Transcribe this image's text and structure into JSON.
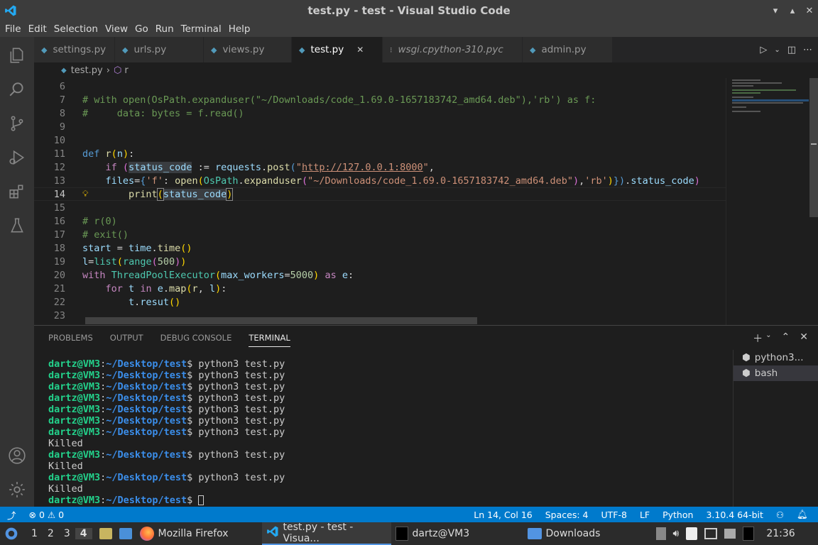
{
  "window": {
    "title": "test.py - test - Visual Studio Code"
  },
  "menu": [
    "File",
    "Edit",
    "Selection",
    "View",
    "Go",
    "Run",
    "Terminal",
    "Help"
  ],
  "tabs": [
    {
      "label": "settings.py",
      "italic": false
    },
    {
      "label": "urls.py",
      "italic": false
    },
    {
      "label": "views.py",
      "italic": false
    },
    {
      "label": "test.py",
      "italic": false,
      "active": true
    },
    {
      "label": "wsgi.cpython-310.pyc",
      "italic": true
    },
    {
      "label": "admin.py",
      "italic": false
    }
  ],
  "breadcrumb": {
    "file": "test.py",
    "symbol": "r"
  },
  "editor": {
    "lines": [
      {
        "n": "6",
        "html": ""
      },
      {
        "n": "7",
        "html": "<span class=\"cm\"># with open(OsPath.expanduser(\"~/Downloads/code_1.69.0-1657183742_amd64.deb\"),'rb') as f:</span>"
      },
      {
        "n": "8",
        "html": "<span class=\"cm\">#     data: bytes = f.read()</span>"
      },
      {
        "n": "9",
        "html": ""
      },
      {
        "n": "10",
        "html": ""
      },
      {
        "n": "11",
        "html": "<span class=\"kw\">def</span> <span class=\"fn\">r</span><span class=\"br\">(</span><span class=\"vr\">n</span><span class=\"br\">)</span>:"
      },
      {
        "n": "12",
        "html": "    <span class=\"kf\">if</span> <span class=\"br2\">(</span><span class=\"vr\" style=\"background:#3a3d41\">status_code</span> := <span class=\"vr\">requests</span>.<span class=\"fn\">post</span><span class=\"kw\">(</span><span class=\"st\">\"<u>http://127.0.0.1:8000</u>\"</span>,"
      },
      {
        "n": "13",
        "html": "    <span class=\"vr\">files</span>=<span class=\"kw\">{</span><span class=\"st\">'f'</span>: <span class=\"fn\">open</span><span class=\"br\">(</span><span class=\"ty\">OsPath</span>.<span class=\"fn\">expanduser</span><span class=\"br2\">(</span><span class=\"st\">\"~/Downloads/code_1.69.0-1657183742_amd64.deb\"</span><span class=\"br2\">)</span>,<span class=\"st\">'rb'</span><span class=\"br\">)</span><span class=\"kw\">})</span>.<span class=\"vr\">status_code</span><span class=\"br2\">)</span>"
      },
      {
        "n": "14",
        "html": "        <span class=\"fn\">print</span><span class=\"br\" style=\"outline:1px solid #888\">(</span><span class=\"vr\" style=\"background:#3a3d41\">status_code</span><span class=\"br\" style=\"outline:1px solid #888\">)</span>"
      },
      {
        "n": "15",
        "html": ""
      },
      {
        "n": "16",
        "html": "<span class=\"cm\"># r(0)</span>"
      },
      {
        "n": "17",
        "html": "<span class=\"cm\"># exit()</span>"
      },
      {
        "n": "18",
        "html": "<span class=\"vr\">start</span> = <span class=\"vr\">time</span>.<span class=\"fn\">time</span><span class=\"br\">()</span>"
      },
      {
        "n": "19",
        "html": "<span class=\"vr\">l</span>=<span class=\"ty\">list</span><span class=\"br\">(</span><span class=\"ty\">range</span><span class=\"br2\">(</span><span class=\"nm\">500</span><span class=\"br2\">)</span><span class=\"br\">)</span>"
      },
      {
        "n": "20",
        "html": "<span class=\"kf\">with</span> <span class=\"ty\">ThreadPoolExecutor</span><span class=\"br\">(</span><span class=\"vr\">max_workers</span>=<span class=\"nm\">5000</span><span class=\"br\">)</span> <span class=\"kf\">as</span> <span class=\"vr\">e</span>:"
      },
      {
        "n": "21",
        "html": "    <span class=\"kf\">for</span> <span class=\"vr\">t</span> <span class=\"kf\">in</span> <span class=\"vr\">e</span>.<span class=\"fn\">map</span><span class=\"br\">(</span><span class=\"fn\">r</span>, <span class=\"vr\">l</span><span class=\"br\">)</span>:"
      },
      {
        "n": "22",
        "html": "        <span class=\"vr\">t</span>.<span class=\"vr\">resut</span><span class=\"br\">()</span>"
      },
      {
        "n": "23",
        "html": ""
      }
    ],
    "current_line": "14"
  },
  "panel": {
    "tabs": [
      "PROBLEMS",
      "OUTPUT",
      "DEBUG CONSOLE",
      "TERMINAL"
    ],
    "active": "TERMINAL",
    "terminal_lines": [
      {
        "user": "dartz@VM3",
        "path": "~/Desktop/test",
        "cmd": "python3 test.py"
      },
      {
        "user": "dartz@VM3",
        "path": "~/Desktop/test",
        "cmd": "python3 test.py"
      },
      {
        "user": "dartz@VM3",
        "path": "~/Desktop/test",
        "cmd": "python3 test.py"
      },
      {
        "user": "dartz@VM3",
        "path": "~/Desktop/test",
        "cmd": "python3 test.py"
      },
      {
        "user": "dartz@VM3",
        "path": "~/Desktop/test",
        "cmd": "python3 test.py"
      },
      {
        "user": "dartz@VM3",
        "path": "~/Desktop/test",
        "cmd": "python3 test.py"
      },
      {
        "user": "dartz@VM3",
        "path": "~/Desktop/test",
        "cmd": "python3 test.py"
      },
      {
        "text": "Killed"
      },
      {
        "user": "dartz@VM3",
        "path": "~/Desktop/test",
        "cmd": "python3 test.py"
      },
      {
        "text": "Killed"
      },
      {
        "user": "dartz@VM3",
        "path": "~/Desktop/test",
        "cmd": "python3 test.py"
      },
      {
        "text": "Killed"
      },
      {
        "user": "dartz@VM3",
        "path": "~/Desktop/test",
        "cmd": "",
        "cursor": true
      }
    ],
    "terminal_list": [
      "python3...",
      "bash"
    ]
  },
  "statusbar": {
    "errors": "0",
    "warnings": "0",
    "position": "Ln 14, Col 16",
    "spaces": "Spaces: 4",
    "encoding": "UTF-8",
    "eol": "LF",
    "language": "Python",
    "interpreter": "3.10.4 64-bit"
  },
  "taskbar": {
    "workspaces": [
      "1",
      "2",
      "3",
      "4"
    ],
    "apps": [
      {
        "label": "Mozilla Firefox",
        "icon": "firefox-icon"
      },
      {
        "label": "test.py - test - Visua...",
        "icon": "vscode-icon",
        "active": true
      },
      {
        "label": "dartz@VM3",
        "icon": "terminal-icon"
      },
      {
        "label": "Downloads",
        "icon": "folder-icon"
      }
    ],
    "clock": "21:36"
  }
}
